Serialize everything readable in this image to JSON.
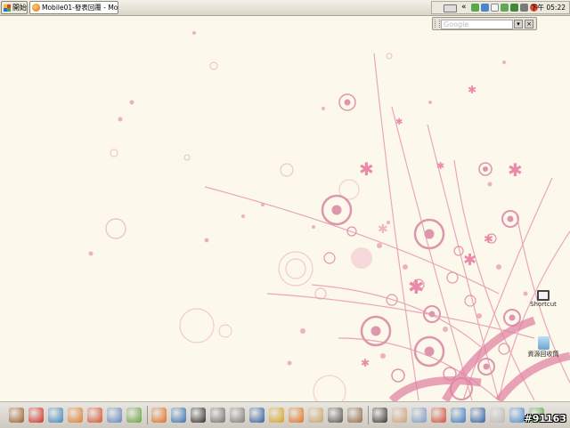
{
  "taskbar": {
    "start_label": "開始",
    "active_task": "Mobile01-發表回覆 - Mo...",
    "tray_chevron": "«",
    "clock": "下午 05:22",
    "tray_icons": [
      "keyboard-icon",
      "recycle-icon",
      "shield-icon",
      "chat-icon",
      "network-icon",
      "monitor-icon",
      "speaker-icon",
      "globe-icon"
    ]
  },
  "google_bar": {
    "placeholder": "Google",
    "menu_button": "▾",
    "close_button": "×"
  },
  "desktop_icons": [
    {
      "label": "Shortcut",
      "icon": "easel-icon"
    },
    {
      "label": "資源回收筒",
      "icon": "recycle-bin-icon"
    }
  ],
  "dock_icons": [
    {
      "name": "football-icon",
      "color": "#9b5b2a"
    },
    {
      "name": "acrobat-icon",
      "color": "#d12a23"
    },
    {
      "name": "picture-viewer-icon",
      "color": "#3b85c4"
    },
    {
      "name": "paint-icon",
      "color": "#e07a25"
    },
    {
      "name": "eye-icon",
      "color": "#d94e2c"
    },
    {
      "name": "arrow-tool-icon",
      "color": "#5f83c8"
    },
    {
      "name": "leaf-icon",
      "color": "#64a33a"
    },
    {
      "name": "firefox-icon",
      "color": "#e36a1c"
    },
    {
      "name": "thunderbird-icon",
      "color": "#2f6fb4"
    },
    {
      "name": "piano-icon",
      "color": "#2b2b2b"
    },
    {
      "name": "winamp-icon",
      "color": "#6e6e6e"
    },
    {
      "name": "wrench-icon",
      "color": "#7a7a7a"
    },
    {
      "name": "book-icon",
      "color": "#2c5d9f"
    },
    {
      "name": "sunflower-icon",
      "color": "#d8a019"
    },
    {
      "name": "play-icon",
      "color": "#e0701d"
    },
    {
      "name": "documents-icon",
      "color": "#c6a46a"
    },
    {
      "name": "pen-icon",
      "color": "#555555"
    },
    {
      "name": "brush-icon",
      "color": "#8a6a4a"
    },
    {
      "name": "bug-icon",
      "color": "#333333"
    },
    {
      "name": "hand-icon",
      "color": "#c9a07a"
    },
    {
      "name": "pin-icon",
      "color": "#7a9ac7"
    },
    {
      "name": "palette-icon",
      "color": "#d34a3a"
    },
    {
      "name": "photo-icon",
      "color": "#3a78c2"
    },
    {
      "name": "image-editor-icon",
      "color": "#2a5fa5"
    },
    {
      "name": "calculator-icon",
      "color": "#b9b9b9"
    },
    {
      "name": "globe-icon",
      "color": "#4a8ad1"
    },
    {
      "name": "recycle-icon",
      "color": "#5aa34a"
    }
  ],
  "watermark": "#91163",
  "colors": {
    "wallpaper": "#fdf8ec",
    "accent_pink": "#e79ab3",
    "ring_pink": "#d9869f"
  }
}
